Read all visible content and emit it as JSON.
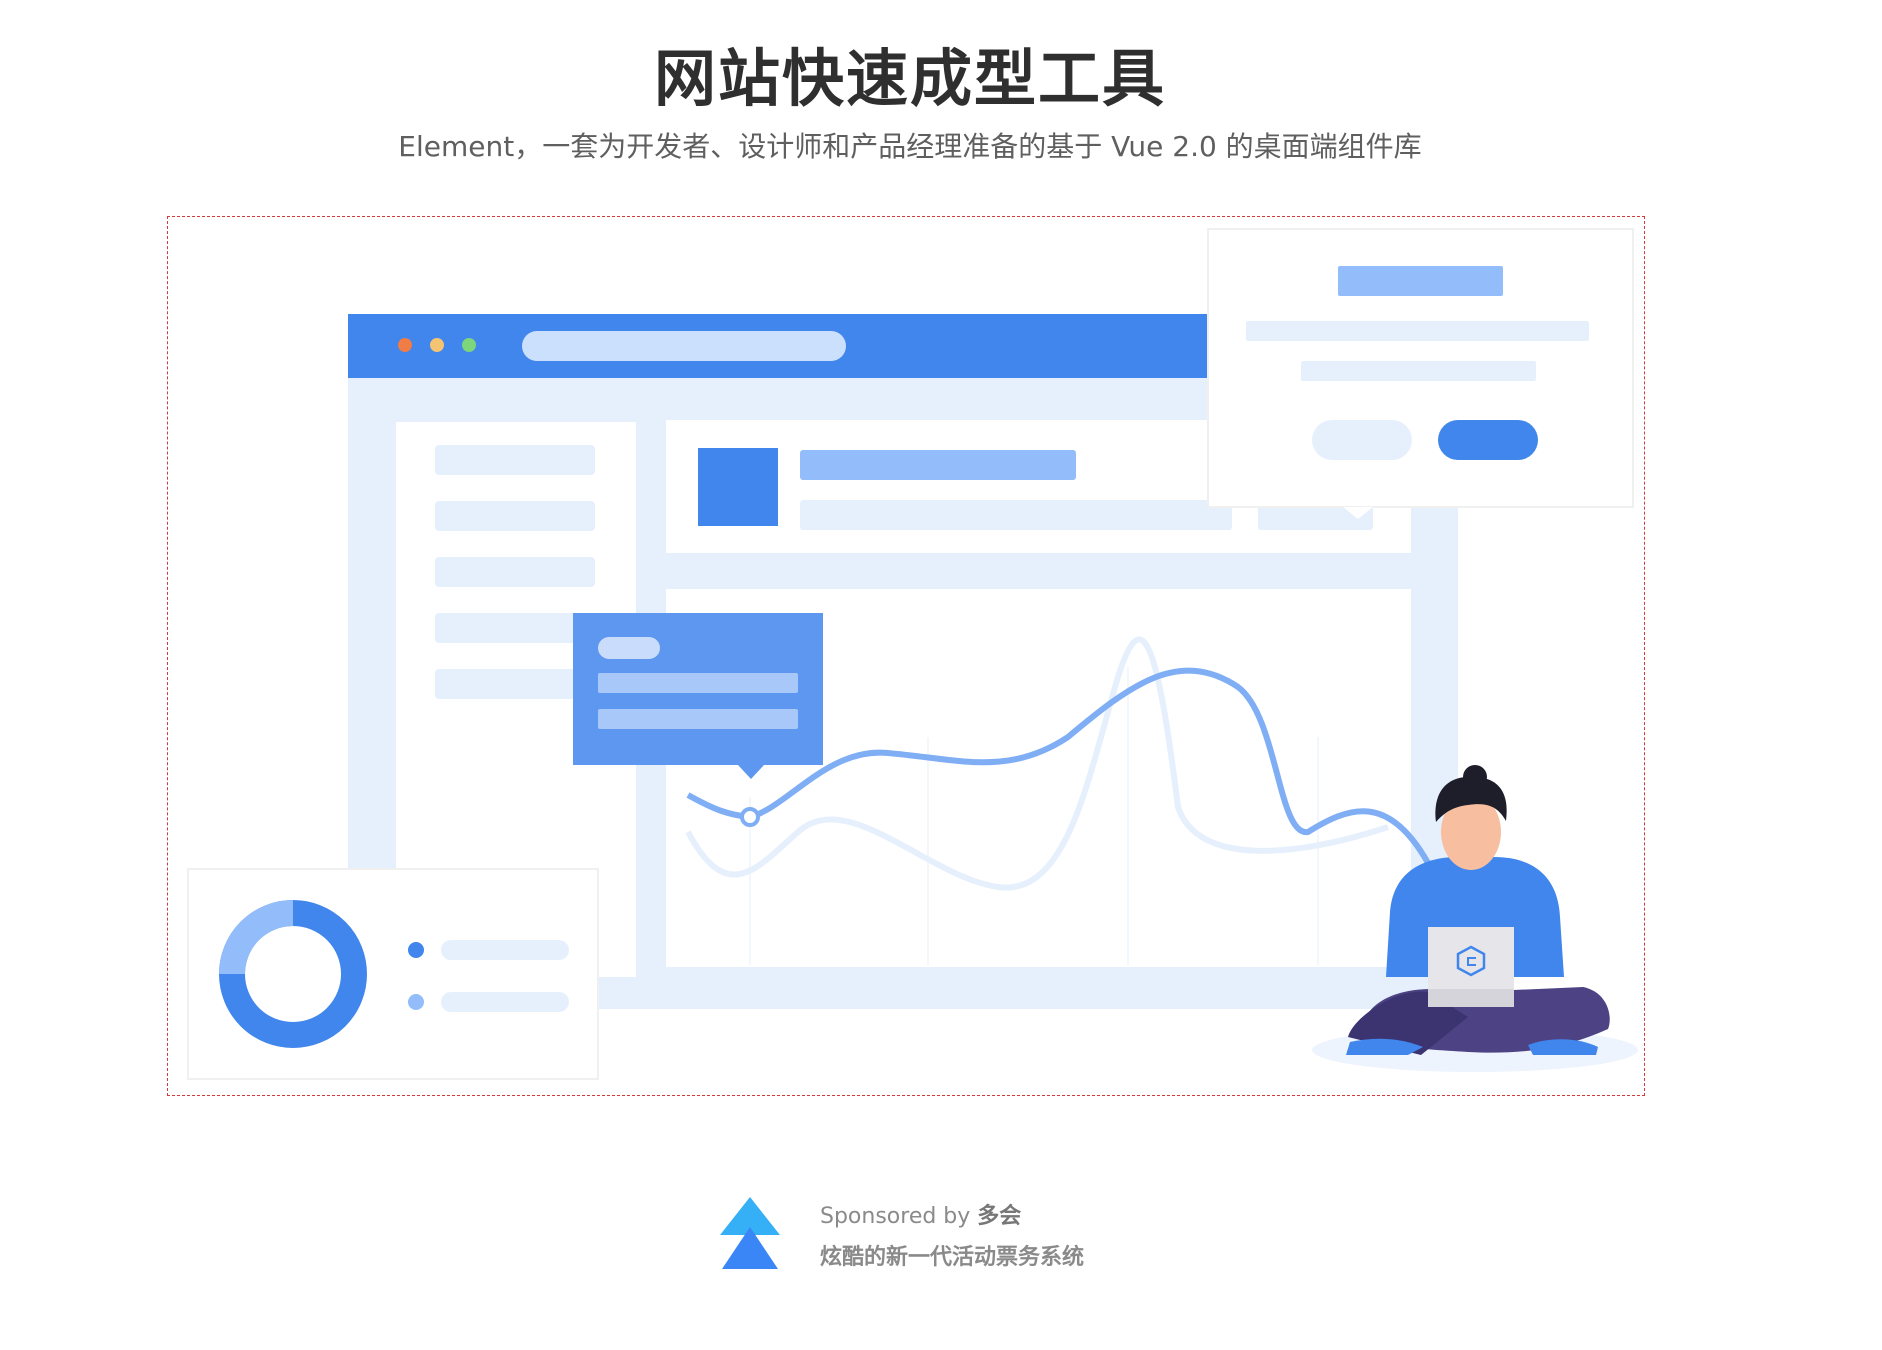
{
  "hero": {
    "title": "网站快速成型工具",
    "subtitle": "Element，一套为开发者、设计师和产品经理准备的基于 Vue 2.0 的桌面端组件库"
  },
  "banner": {
    "illustration": "developer-with-laptop-dashboard-illustration",
    "colors": {
      "primary": "#4086ec",
      "light": "#e6f0fd",
      "mid": "#93bdfa",
      "dark_purple": "#4c4284"
    }
  },
  "sponsor": {
    "prefix": "Sponsored by",
    "name": "多会",
    "tagline": "炫酷的新一代活动票务系统",
    "logo_icon": "duohui-logo-icon",
    "colors": {
      "top": "#35b0f6",
      "bottom": "#3a86f6"
    }
  }
}
